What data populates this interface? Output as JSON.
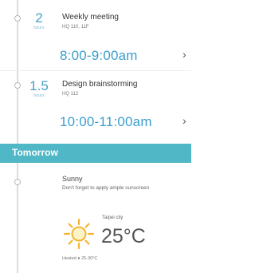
{
  "events": [
    {
      "duration_value": "2",
      "duration_unit": "hours",
      "title": "Weekly meeting",
      "location": "HQ 110, 11F",
      "time": "8:00-9:00am",
      "chevron_icon": "chevron-right-icon"
    },
    {
      "duration_value": "1.5",
      "duration_unit": "hours",
      "title": "Design brainstorming",
      "location": "HQ 112",
      "time": "10:00-11:00am",
      "chevron_icon": "chevron-right-icon"
    }
  ],
  "banner": {
    "label": "Tomorrow",
    "color": "#4fb7c6"
  },
  "weather": {
    "condition": "Sunny",
    "note": "Don't forget to apply ample sunscreen",
    "city": "Taipei city",
    "temperature": "25°C",
    "footer": "Heated  ● 25-30°C",
    "icon": "sun-icon"
  },
  "colors": {
    "accent": "#3a9fcd",
    "timeline": "#dcdcdc"
  }
}
